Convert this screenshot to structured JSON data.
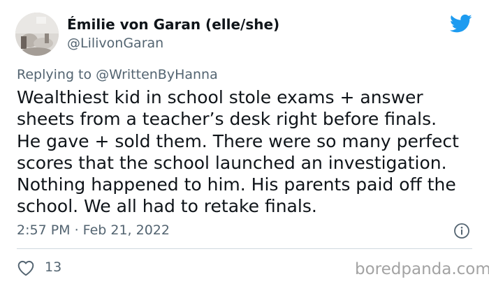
{
  "author": {
    "name": "Émilie von Garan (elle/she)",
    "handle": "@LilivonGaran"
  },
  "reply": {
    "prefix": "Replying to ",
    "mention": "@WrittenByHanna"
  },
  "tweet": {
    "lines": [
      "Wealthiest kid in school stole exams + answer",
      "sheets from a teacher’s desk right before finals.",
      "He gave + sold them. There were so many perfect",
      "scores that the school launched an investigation.",
      "Nothing happened to him. His parents paid off the",
      "school. We all had to retake finals."
    ],
    "timestamp": "2:57 PM · Feb 21, 2022",
    "likes": "13"
  },
  "watermark": "boredpanda.com",
  "icons": {
    "logo": "twitter-bird-icon",
    "info": "info-icon",
    "like": "heart-icon"
  },
  "colors": {
    "brand": "#1d9bf0",
    "text": "#0f1419",
    "muted": "#536471",
    "divider": "#cfd9de",
    "watermark": "#a3a3a3"
  }
}
